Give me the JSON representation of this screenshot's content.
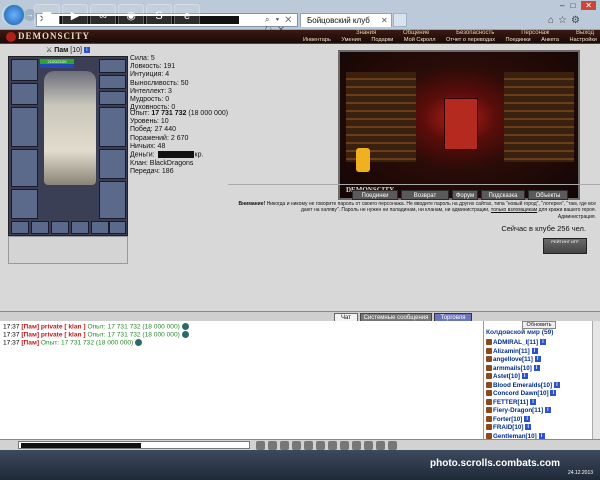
{
  "browser": {
    "tab_title": "Бойцовский клуб",
    "address_tools": "⌕ ▾ ✕ ↻ ✕"
  },
  "game": {
    "logo": "DEMONSCITY",
    "nav_top": [
      "Знания",
      "Общение",
      "Безопасность",
      "Персонаж",
      "Выход"
    ],
    "nav_bottom": [
      "Инвентарь",
      "Умения",
      "Подарки",
      "Мой Скролл",
      "Отчет о переводах",
      "Поединки",
      "Анкета",
      "Настройки"
    ]
  },
  "character": {
    "name": "Пам",
    "level": "[10]",
    "hp": "2100/2100",
    "mp": "0/2"
  },
  "stats": [
    "Сила: 5",
    "Ловкость: 191",
    "Интуиция: 4",
    "Выносливость: 50",
    "Интеллект: 3",
    "Мудрость: 0",
    "Духовность: 0"
  ],
  "exp": {
    "label": "Опыт: ",
    "value": "17 731 732",
    "next": " (18 000 000)"
  },
  "info": [
    "Уровень: 10",
    "Побед: 27 440",
    "Поражений: 2 670",
    "Ничьих: 48"
  ],
  "money": {
    "label": "Деньги: ",
    "suffix": "кр."
  },
  "clan": "Клан: BlackDragons",
  "transfers": "Передач: 186",
  "scene_label": "DEMONSCITY",
  "buttons": [
    "Поединки",
    "Возврат",
    "Форум",
    "Подсказка",
    "Объекты"
  ],
  "notice": {
    "bold": "Внимание!",
    "text": " Никогда и никому не говорите пароль от своего персонажа. Не вводите пароль на других сайтах, типа \"новый город\", \"лотерея\", \"там, где все дают на халяву\". Пароль не нужен ни паладинам, ни кланам, ни администрации,",
    "link": "только взломщикам",
    "text2": " для кражи вашего героя.",
    "sign": "Администрация."
  },
  "online": "Сейчас в клубе 256 чел.",
  "rating": "РЕЙТИНГ ИГР",
  "chat": {
    "tabs": {
      "chat": "Чат",
      "system": "Системные сообщения",
      "trade": "Торговля"
    },
    "lines": [
      {
        "time": "17:37",
        "nick": "[Пам]",
        "private": "private [ klan ]",
        "msg": "Опыт: 17 731 732 (18 000 000)"
      },
      {
        "time": "17:37",
        "nick": "[Пам]",
        "private": "private [ klan ]",
        "msg": "Опыт: 17 731 732 (18 000 000)"
      },
      {
        "time": "17:37",
        "nick": "[Пам]",
        "private": "",
        "msg": "Опыт: 17 731 732 (18 000 000)"
      }
    ]
  },
  "players_panel": {
    "refresh": "Обновить",
    "location": "Колдовской мир (59)",
    "players": [
      "ADMIRAL_I[11]",
      "Alizamin[11]",
      "angellove[11]",
      "armmails[10]",
      "Astet[10]",
      "Blood Emeralds[10]",
      "Concord Dawn[10]",
      "FETTER[11]",
      "Fiery-Dragon[11]",
      "Forter[10]",
      "FRAID[10]",
      "Gentleman[10]"
    ]
  },
  "taskbar": {
    "watermark": "photo.scrolls.combats.com",
    "date": "24.12.2013"
  },
  "colors": {
    "accent_red": "#c01818",
    "exp_green": "#2a8a2a",
    "player_blue": "#002c8c"
  }
}
